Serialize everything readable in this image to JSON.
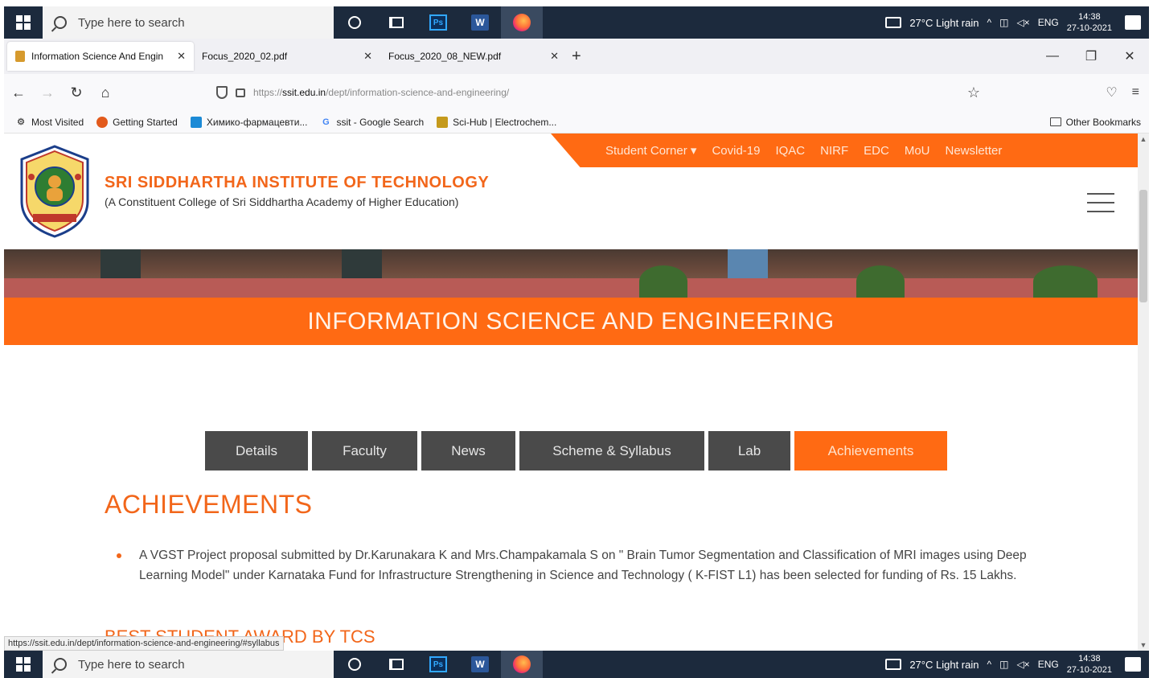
{
  "taskbar": {
    "search_placeholder": "Type here to search",
    "apps": [
      "cortana-icon",
      "taskview-icon",
      "photoshop-icon",
      "word-icon",
      "firefox-icon"
    ],
    "weather": "27°C  Light rain",
    "lang": "ENG",
    "time": "14:38",
    "date": "27-10-2021"
  },
  "browser": {
    "tabs": [
      {
        "title": "Information Science And Engin",
        "active": true
      },
      {
        "title": "Focus_2020_02.pdf",
        "active": false
      },
      {
        "title": "Focus_2020_08_NEW.pdf",
        "active": false
      }
    ],
    "url_prefix": "https://",
    "url_host": "ssit.edu.in",
    "url_path": "/dept/information-science-and-engineering/",
    "bookmarks": [
      {
        "label": "Most Visited",
        "icon": "gear-icon",
        "color": "#555555"
      },
      {
        "label": "Getting Started",
        "icon": "firefox-icon",
        "color": "#e25a1c"
      },
      {
        "label": "Химико-фармацевти...",
        "icon": "journal-icon",
        "color": "#1c8ad6"
      },
      {
        "label": "ssit - Google Search",
        "icon": "google-icon",
        "color": "#4285f4"
      },
      {
        "label": "Sci-Hub | Electrochem...",
        "icon": "scihub-icon",
        "color": "#c59a1c"
      }
    ],
    "other_bookmarks": "Other Bookmarks",
    "status_url": "https://ssit.edu.in/dept/information-science-and-engineering/#syllabus"
  },
  "site": {
    "topnav": [
      "Student Corner ▾",
      "Covid-19",
      "IQAC",
      "NIRF",
      "EDC",
      "MoU",
      "Newsletter"
    ],
    "institute_name": "SRI SIDDHARTHA INSTITUTE OF TECHNOLOGY",
    "institute_sub": "(A Constituent College of Sri Siddhartha Academy of Higher Education)",
    "page_title": "INFORMATION SCIENCE AND ENGINEERING",
    "dept_tabs": [
      {
        "label": "Details",
        "active": false
      },
      {
        "label": "Faculty",
        "active": false
      },
      {
        "label": "News",
        "active": false
      },
      {
        "label": "Scheme & Syllabus",
        "active": false
      },
      {
        "label": "Lab",
        "active": false
      },
      {
        "label": "Achievements",
        "active": true
      }
    ],
    "achievements_heading": "ACHIEVEMENTS",
    "achievements": [
      "A VGST Project proposal submitted by Dr.Karunakara K and Mrs.Champakamala S on \" Brain Tumor Segmentation and Classification of MRI images using Deep Learning Model\" under Karnataka Fund for Infrastructure Strengthening in Science and Technology ( K-FIST L1) has been selected for funding of Rs. 15 Lakhs."
    ],
    "next_heading_partial": "BEST STUDENT AWARD BY TCS"
  },
  "colors": {
    "brand_orange": "#ff6a13",
    "tab_dark": "#4a4a4a",
    "taskbar": "#1c2a3d"
  }
}
